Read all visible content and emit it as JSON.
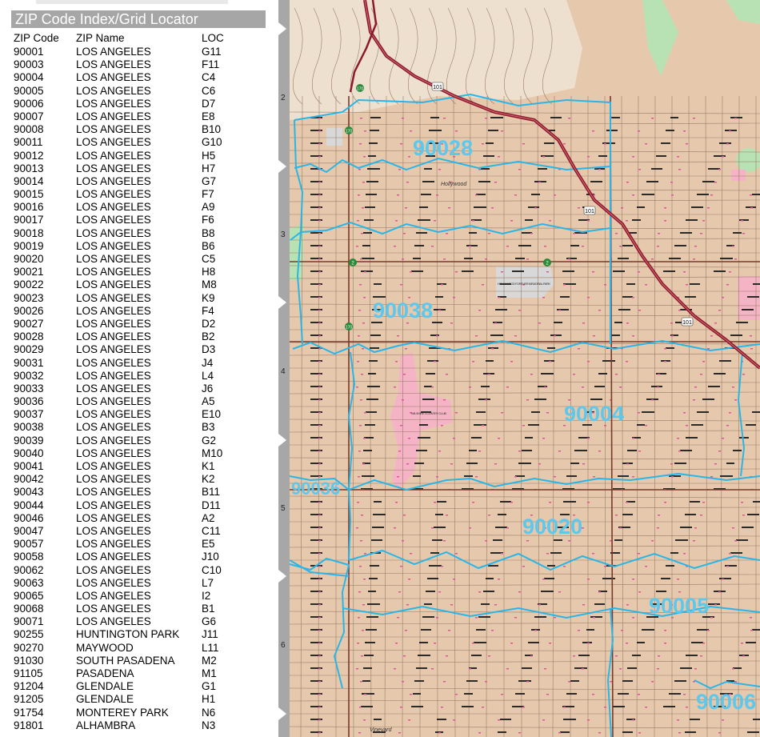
{
  "index": {
    "title": "ZIP Code Index/Grid Locator",
    "headers": {
      "zip": "ZIP Code",
      "name": "ZIP Name",
      "loc": "LOC"
    },
    "rows": [
      {
        "zip": "90001",
        "name": "LOS ANGELES",
        "loc": "G11"
      },
      {
        "zip": "90003",
        "name": "LOS ANGELES",
        "loc": "F11"
      },
      {
        "zip": "90004",
        "name": "LOS ANGELES",
        "loc": "C4"
      },
      {
        "zip": "90005",
        "name": "LOS ANGELES",
        "loc": "C6"
      },
      {
        "zip": "90006",
        "name": "LOS ANGELES",
        "loc": "D7"
      },
      {
        "zip": "90007",
        "name": "LOS ANGELES",
        "loc": "E8"
      },
      {
        "zip": "90008",
        "name": "LOS ANGELES",
        "loc": "B10"
      },
      {
        "zip": "90011",
        "name": "LOS ANGELES",
        "loc": "G10"
      },
      {
        "zip": "90012",
        "name": "LOS ANGELES",
        "loc": "H5"
      },
      {
        "zip": "90013",
        "name": "LOS ANGELES",
        "loc": "H7"
      },
      {
        "zip": "90014",
        "name": "LOS ANGELES",
        "loc": "G7"
      },
      {
        "zip": "90015",
        "name": "LOS ANGELES",
        "loc": "F7"
      },
      {
        "zip": "90016",
        "name": "LOS ANGELES",
        "loc": "A9"
      },
      {
        "zip": "90017",
        "name": "LOS ANGELES",
        "loc": "F6"
      },
      {
        "zip": "90018",
        "name": "LOS ANGELES",
        "loc": "B8"
      },
      {
        "zip": "90019",
        "name": "LOS ANGELES",
        "loc": "B6"
      },
      {
        "zip": "90020",
        "name": "LOS ANGELES",
        "loc": "C5"
      },
      {
        "zip": "90021",
        "name": "LOS ANGELES",
        "loc": "H8"
      },
      {
        "zip": "90022",
        "name": "LOS ANGELES",
        "loc": "M8"
      },
      {
        "zip": "90023",
        "name": "LOS ANGELES",
        "loc": "K9"
      },
      {
        "zip": "90026",
        "name": "LOS ANGELES",
        "loc": "F4"
      },
      {
        "zip": "90027",
        "name": "LOS ANGELES",
        "loc": "D2"
      },
      {
        "zip": "90028",
        "name": "LOS ANGELES",
        "loc": "B2"
      },
      {
        "zip": "90029",
        "name": "LOS ANGELES",
        "loc": "D3"
      },
      {
        "zip": "90031",
        "name": "LOS ANGELES",
        "loc": "J4"
      },
      {
        "zip": "90032",
        "name": "LOS ANGELES",
        "loc": "L4"
      },
      {
        "zip": "90033",
        "name": "LOS ANGELES",
        "loc": "J6"
      },
      {
        "zip": "90036",
        "name": "LOS ANGELES",
        "loc": "A5"
      },
      {
        "zip": "90037",
        "name": "LOS ANGELES",
        "loc": "E10"
      },
      {
        "zip": "90038",
        "name": "LOS ANGELES",
        "loc": "B3"
      },
      {
        "zip": "90039",
        "name": "LOS ANGELES",
        "loc": "G2"
      },
      {
        "zip": "90040",
        "name": "LOS ANGELES",
        "loc": "M10"
      },
      {
        "zip": "90041",
        "name": "LOS ANGELES",
        "loc": "K1"
      },
      {
        "zip": "90042",
        "name": "LOS ANGELES",
        "loc": "K2"
      },
      {
        "zip": "90043",
        "name": "LOS ANGELES",
        "loc": "B11"
      },
      {
        "zip": "90044",
        "name": "LOS ANGELES",
        "loc": "D11"
      },
      {
        "zip": "90046",
        "name": "LOS ANGELES",
        "loc": "A2"
      },
      {
        "zip": "90047",
        "name": "LOS ANGELES",
        "loc": "C11"
      },
      {
        "zip": "90057",
        "name": "LOS ANGELES",
        "loc": "E5"
      },
      {
        "zip": "90058",
        "name": "LOS ANGELES",
        "loc": "J10"
      },
      {
        "zip": "90062",
        "name": "LOS ANGELES",
        "loc": "C10"
      },
      {
        "zip": "90063",
        "name": "LOS ANGELES",
        "loc": "L7"
      },
      {
        "zip": "90065",
        "name": "LOS ANGELES",
        "loc": "I2"
      },
      {
        "zip": "90068",
        "name": "LOS ANGELES",
        "loc": "B1"
      },
      {
        "zip": "90071",
        "name": "LOS ANGELES",
        "loc": "G6"
      },
      {
        "zip": "90255",
        "name": "HUNTINGTON PARK",
        "loc": "J11"
      },
      {
        "zip": "90270",
        "name": "MAYWOOD",
        "loc": "L11"
      },
      {
        "zip": "91030",
        "name": "SOUTH PASADENA",
        "loc": "M2"
      },
      {
        "zip": "91105",
        "name": "PASADENA",
        "loc": "M1"
      },
      {
        "zip": "91204",
        "name": "GLENDALE",
        "loc": "G1"
      },
      {
        "zip": "91205",
        "name": "GLENDALE",
        "loc": "H1"
      },
      {
        "zip": "91754",
        "name": "MONTEREY PARK",
        "loc": "N6"
      },
      {
        "zip": "91801",
        "name": "ALHAMBRA",
        "loc": "N3"
      }
    ]
  },
  "map": {
    "grid_rows": [
      "2",
      "3",
      "4",
      "5",
      "6"
    ],
    "zip_labels": [
      "90028",
      "90038",
      "90004",
      "90036",
      "90020",
      "90005",
      "90006"
    ],
    "place_labels": {
      "hollywood": "Hollywood",
      "cemetery": "HOLLYWOOD FOREVER MEMORIAL PARK",
      "wilshire": "WILSHIRE COUNTRY CLUB",
      "vineyard": "Vineyard"
    },
    "shields": {
      "hwy101": "101",
      "hwy170": "170",
      "hwy2": "2"
    },
    "colors": {
      "land": "#e6c9ad",
      "zip_boundary": "#29b6e6",
      "zip_label": "#5ec8ec",
      "freeway": "#8b1a2b",
      "park_pink": "#f5b3c6",
      "park_green": "#b8e2b3",
      "street": "#9a7c66",
      "sidebar": "#a7a7a7"
    }
  }
}
